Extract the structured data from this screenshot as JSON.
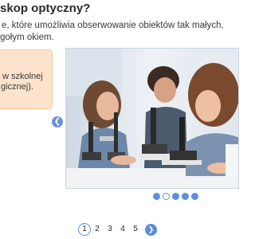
{
  "lesson": {
    "question": "skop optyczny?",
    "description_lines": [
      "e, które umożliwia obserwowanie obiektów tak małych,",
      "gołym okiem."
    ]
  },
  "info_card": {
    "lines": [
      "w szkolnej",
      "gicznej)."
    ],
    "background": "#fde3cc"
  },
  "gallery": {
    "image": "students-with-microscopes",
    "prev_icon": "chevron-left-icon",
    "slides_count": 5,
    "active_slide": 2
  },
  "pagination": {
    "pages": [
      "1",
      "2",
      "3",
      "4",
      "5"
    ],
    "current": "1",
    "next_icon": "chevron-right-icon"
  },
  "colors": {
    "accent": "#5b8ee0",
    "card": "#fde3cc"
  }
}
